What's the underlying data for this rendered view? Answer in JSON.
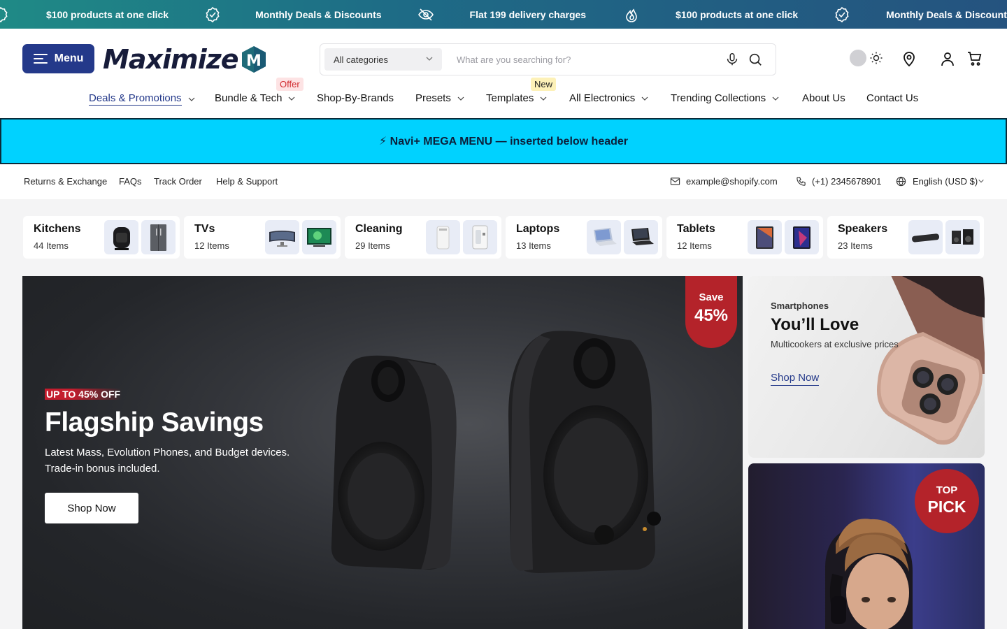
{
  "announcement": {
    "items": [
      {
        "text": "$100 products at one click",
        "icon": "badge-check-icon"
      },
      {
        "text": "Monthly Deals & Discounts",
        "icon": "eye-icon"
      },
      {
        "text": "Flat 199 delivery charges",
        "icon": "flame-icon"
      },
      {
        "text": "$100 products at one click",
        "icon": "badge-check-icon"
      },
      {
        "text": "Monthly Deals & Discounts",
        "icon": "eye-icon"
      }
    ]
  },
  "header": {
    "menu_label": "Menu",
    "logo_text": "Maximize",
    "logo_letter": "M",
    "search": {
      "category": "All categories",
      "placeholder": "What are you searching for?"
    },
    "nav": [
      {
        "label": "Deals & Promotions",
        "dropdown": true,
        "active": true
      },
      {
        "label": "Bundle & Tech",
        "dropdown": true,
        "badge": "Offer"
      },
      {
        "label": "Shop-By-Brands",
        "dropdown": false
      },
      {
        "label": "Presets",
        "dropdown": true
      },
      {
        "label": "Templates",
        "dropdown": true,
        "badge": "New"
      },
      {
        "label": "All Electronics",
        "dropdown": true
      },
      {
        "label": "Trending Collections",
        "dropdown": true
      },
      {
        "label": "About Us",
        "dropdown": false
      },
      {
        "label": "Contact Us",
        "dropdown": false
      }
    ]
  },
  "mega_banner": "⚡ Navi+ MEGA MENU — inserted below header",
  "utility": {
    "links": [
      "Returns & Exchange",
      "FAQs",
      "Track Order",
      "Help & Support"
    ],
    "email": "example@shopify.com",
    "phone": "(+1) 2345678901",
    "language": "English (USD $)"
  },
  "categories": [
    {
      "name": "Kitchens",
      "count": "44 Items"
    },
    {
      "name": "TVs",
      "count": "12 Items"
    },
    {
      "name": "Cleaning",
      "count": "29 Items"
    },
    {
      "name": "Laptops",
      "count": "13 Items"
    },
    {
      "name": "Tablets",
      "count": "12 Items"
    },
    {
      "name": "Speakers",
      "count": "23 Items"
    }
  ],
  "hero": {
    "eyebrow": "UP TO 45% OFF",
    "title": "Flagship Savings",
    "description": "Latest Mass, Evolution Phones, and Budget devices. Trade-in bonus included.",
    "button": "Shop Now",
    "badge_top": "Save",
    "badge_value": "45%"
  },
  "promo_phones": {
    "eyebrow": "Smartphones",
    "title": "You’ll Love",
    "description": "Multicookers at exclusive prices",
    "link": "Shop Now"
  },
  "promo_pick": {
    "badge_top": "TOP",
    "badge_bottom": "PICK"
  },
  "colors": {
    "brand": "#24398a",
    "accent_red": "#b4232a",
    "mega": "#00d2ff"
  }
}
